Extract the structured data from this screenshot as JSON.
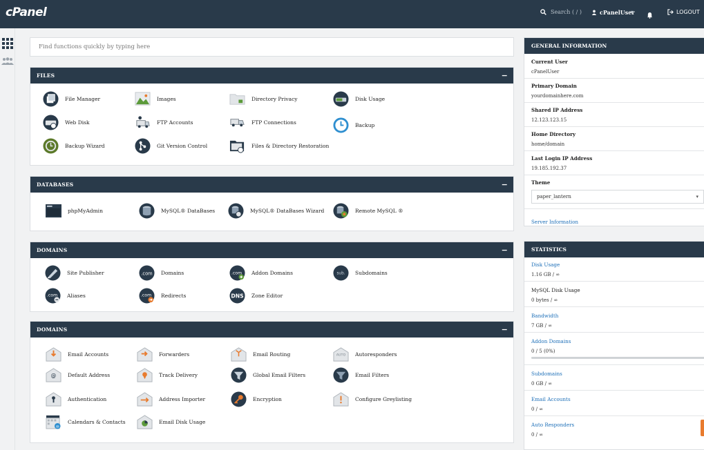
{
  "app": {
    "logo": "cPanel",
    "search_label": "Search ( / )",
    "username": "cPanelUser",
    "logout_label": "LOGOUT"
  },
  "quick_search": {
    "placeholder": "Find functions quickly by typing here"
  },
  "sections": {
    "files": {
      "title": "FILES",
      "toggle": "−",
      "items": [
        "File Manager",
        "Images",
        "Directory Privacy",
        "Disk Usage",
        "Web Disk",
        "FTP Accounts",
        "FTP Connections",
        "Backup",
        "Backup Wizard",
        "Git Version Control",
        "Files & Directory Restoration"
      ]
    },
    "databases": {
      "title": "DATABASES",
      "toggle": "−",
      "items": [
        "phpMyAdmin",
        "MySQL® DataBases",
        "MySQL® DataBases Wizard",
        "Remote MySQL ®"
      ]
    },
    "domains": {
      "title": "DOMAINS",
      "toggle": "−",
      "items": [
        "Site Publisher",
        "Domains",
        "Addon Domains",
        "Subdomains",
        "Aliases",
        "Redirects",
        "Zone Editor"
      ]
    },
    "email": {
      "title": "DOMAINS",
      "toggle": "−",
      "items": [
        "Email Accounts",
        "Forwarders",
        "Email Routing",
        "Autoresponders",
        "Default Address",
        "Track Delivery",
        "Global Email Filters",
        "Email Filters",
        "Authentication",
        "Address Importer",
        "Encryption",
        "Configure Greylisting",
        "Calendars & Contacts",
        "Email Disk Usage"
      ]
    }
  },
  "general_info": {
    "title": "GENERAL INFORMATION",
    "rows": [
      {
        "label": "Current User",
        "value": "cPanelUser"
      },
      {
        "label": "Primary Domain",
        "value": "yourdomainhere.com"
      },
      {
        "label": "Shared IP Address",
        "value": "12.123.123.15"
      },
      {
        "label": "Home Directory",
        "value": "home/domain"
      },
      {
        "label": "Last Login IP Address",
        "value": "19.185.192.37"
      }
    ],
    "theme_label": "Theme",
    "theme_value": "paper_lantern",
    "server_info_link": "Server Information"
  },
  "statistics": {
    "title": "STATISTICS",
    "rows": [
      {
        "label": "Disk Usage",
        "value": "1.16 GB / ∞"
      },
      {
        "label": "MySQL Disk Usage",
        "value": "0 bytes / ∞"
      },
      {
        "label": "Bandwidth",
        "value": "7 GB / ∞"
      },
      {
        "label": "Addon Domains",
        "value": "0 / 5 (0%)"
      },
      {
        "label": "Subdomains",
        "value": "0 GB / ∞"
      },
      {
        "label": "Email Accounts",
        "value": "0 / ∞"
      },
      {
        "label": "Auto Responders",
        "value": "0 / ∞"
      }
    ],
    "addon_domains_progress": 0
  },
  "colors": {
    "header": "#293a4a",
    "link": "#1d6fb8",
    "accent": "#e87b2e"
  }
}
